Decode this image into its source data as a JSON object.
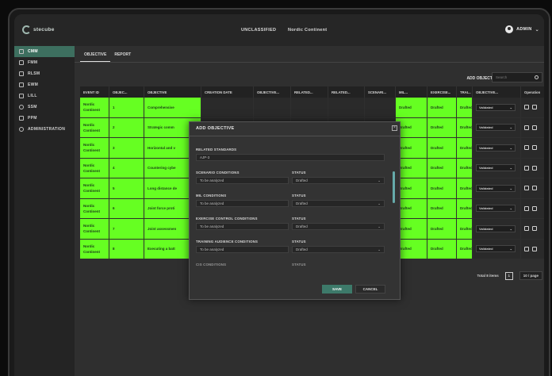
{
  "app": {
    "logo_text": "stecube",
    "classification": "UNCLASSIFIED",
    "region": "Nordic Continent",
    "user": "ADMIN"
  },
  "sidebar": {
    "items": [
      {
        "label": "CMM",
        "active": true
      },
      {
        "label": "FMM"
      },
      {
        "label": "RLSM"
      },
      {
        "label": "EWM"
      },
      {
        "label": "LILL"
      },
      {
        "label": "SSM"
      },
      {
        "label": "PPM"
      },
      {
        "label": "ADMINISTRATION"
      }
    ]
  },
  "tabs": [
    {
      "label": "OBJECTIVE",
      "active": true
    },
    {
      "label": "REPORT"
    }
  ],
  "toolbar": {
    "add_label": "ADD OBJECTIVE",
    "search_placeholder": "Search"
  },
  "table": {
    "headers": [
      "EVENT ID",
      "OBJEC...",
      "OBJECTIVE",
      "CREATION DATE",
      "OBJECTIVE...",
      "RELATED...",
      "RELATED...",
      "SCENARI...",
      "MIL...",
      "EXERCISE...",
      "TRAI...",
      "OBJECTIVE...",
      "Operation"
    ],
    "rows": [
      {
        "event": "Nordic Continent",
        "id": "1",
        "objective": "Comprehensive",
        "mil": "Drafted",
        "exercise": "Drafted",
        "train": "Drafted",
        "status": "Validated"
      },
      {
        "event": "Nordic Continent",
        "id": "2",
        "objective": "Strategic comm",
        "mil": "Drafted",
        "exercise": "Drafted",
        "train": "Drafted",
        "status": "Validated"
      },
      {
        "event": "Nordic Continent",
        "id": "3",
        "objective": "Horizontal and v",
        "mil": "Drafted",
        "exercise": "Drafted",
        "train": "Drafted",
        "status": "Validated"
      },
      {
        "event": "Nordic Continent",
        "id": "4",
        "objective": "Countering cybe",
        "mil": "Drafted",
        "exercise": "Drafted",
        "train": "Drafted",
        "status": "Validated"
      },
      {
        "event": "Nordic Continent",
        "id": "5",
        "objective": "Long distance de",
        "mil": "Drafted",
        "exercise": "Drafted",
        "train": "Drafted",
        "status": "Validated"
      },
      {
        "event": "Nordic Continent",
        "id": "6",
        "objective": "Joint force proti",
        "mil": "Drafted",
        "exercise": "Drafted",
        "train": "Drafted",
        "status": "Validated"
      },
      {
        "event": "Nordic Continent",
        "id": "7",
        "objective": "Joint assessmen",
        "mil": "Drafted",
        "exercise": "Drafted",
        "train": "Drafted",
        "status": "Validated"
      },
      {
        "event": "Nordic Continent",
        "id": "8",
        "objective": "Executing a batt",
        "mil": "Drafted",
        "exercise": "Drafted",
        "train": "Drafted",
        "status": "Validated"
      }
    ]
  },
  "pagination": {
    "total": "Total 8 items",
    "page": "1",
    "size": "10 / page"
  },
  "modal": {
    "title": "ADD OBJECTIVE",
    "related_label": "RELATED STANDARDS",
    "related_value": "AJP-3",
    "conditions": [
      {
        "label": "SCENARIO CONDITIONS",
        "value": "To be analyzed",
        "status_label": "STATUS",
        "status": "Drafted"
      },
      {
        "label": "MIL CONDITIONS",
        "value": "To be analyzed",
        "status_label": "STATUS",
        "status": "Drafted"
      },
      {
        "label": "EXERCISE CONTROL CONDITIONS",
        "value": "To be analyzed",
        "status_label": "STATUS",
        "status": "Drafted"
      },
      {
        "label": "TRAINING AUDIENCE CONDITIONS",
        "value": "To be analyzed",
        "status_label": "STATUS",
        "status": "Drafted"
      }
    ],
    "cut_label": "CIS CONDITIONS",
    "cut_status": "STATUS",
    "save": "SAVE",
    "cancel": "CANCEL"
  },
  "colors": {
    "accent": "#3d7a6a",
    "row_green": "#66ff22"
  }
}
